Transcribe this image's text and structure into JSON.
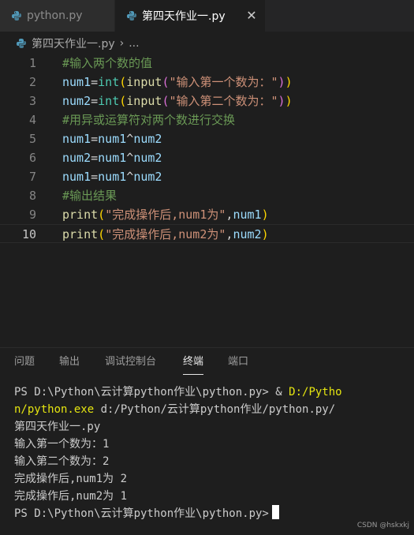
{
  "tabs": [
    {
      "label": "python.py",
      "active": false
    },
    {
      "label": "第四天作业一.py",
      "active": true
    }
  ],
  "breadcrumb": {
    "file": "第四天作业一.py",
    "more": "..."
  },
  "editor": {
    "line_numbers": [
      "1",
      "2",
      "3",
      "4",
      "5",
      "6",
      "7",
      "8",
      "9",
      "10"
    ],
    "current_line": 10,
    "lines": [
      [
        {
          "t": "#输入两个数的值",
          "c": "c-com"
        }
      ],
      [
        {
          "t": "num1",
          "c": "c-var"
        },
        {
          "t": "=",
          "c": "c-op"
        },
        {
          "t": "int",
          "c": "c-type"
        },
        {
          "t": "(",
          "c": "b1"
        },
        {
          "t": "input",
          "c": "c-fn"
        },
        {
          "t": "(",
          "c": "b2"
        },
        {
          "t": "\"输入第一个数为：\"",
          "c": "c-str"
        },
        {
          "t": ")",
          "c": "b2"
        },
        {
          "t": ")",
          "c": "b1"
        }
      ],
      [
        {
          "t": "num2",
          "c": "c-var"
        },
        {
          "t": "=",
          "c": "c-op"
        },
        {
          "t": "int",
          "c": "c-type"
        },
        {
          "t": "(",
          "c": "b1"
        },
        {
          "t": "input",
          "c": "c-fn"
        },
        {
          "t": "(",
          "c": "b2"
        },
        {
          "t": "\"输入第二个数为：\"",
          "c": "c-str"
        },
        {
          "t": ")",
          "c": "b2"
        },
        {
          "t": ")",
          "c": "b1"
        }
      ],
      [
        {
          "t": "#用异或运算符对两个数进行交换",
          "c": "c-com"
        }
      ],
      [
        {
          "t": "num1",
          "c": "c-var"
        },
        {
          "t": "=",
          "c": "c-op"
        },
        {
          "t": "num1",
          "c": "c-var"
        },
        {
          "t": "^",
          "c": "c-op"
        },
        {
          "t": "num2",
          "c": "c-var"
        }
      ],
      [
        {
          "t": "num2",
          "c": "c-var"
        },
        {
          "t": "=",
          "c": "c-op"
        },
        {
          "t": "num1",
          "c": "c-var"
        },
        {
          "t": "^",
          "c": "c-op"
        },
        {
          "t": "num2",
          "c": "c-var"
        }
      ],
      [
        {
          "t": "num1",
          "c": "c-var"
        },
        {
          "t": "=",
          "c": "c-op"
        },
        {
          "t": "num1",
          "c": "c-var"
        },
        {
          "t": "^",
          "c": "c-op"
        },
        {
          "t": "num2",
          "c": "c-var"
        }
      ],
      [
        {
          "t": "#输出结果",
          "c": "c-com"
        }
      ],
      [
        {
          "t": "print",
          "c": "c-fn"
        },
        {
          "t": "(",
          "c": "b1"
        },
        {
          "t": "\"完成操作后,num1为\"",
          "c": "c-str"
        },
        {
          "t": ",",
          "c": "c-op"
        },
        {
          "t": "num1",
          "c": "c-var"
        },
        {
          "t": ")",
          "c": "b1"
        }
      ],
      [
        {
          "t": "print",
          "c": "c-fn"
        },
        {
          "t": "(",
          "c": "b1"
        },
        {
          "t": "\"完成操作后,num2为\"",
          "c": "c-str"
        },
        {
          "t": ",",
          "c": "c-op"
        },
        {
          "t": "num2",
          "c": "c-var"
        },
        {
          "t": ")",
          "c": "b1"
        }
      ]
    ]
  },
  "panel": {
    "tabs": [
      {
        "label": "问题",
        "active": false
      },
      {
        "label": "输出",
        "active": false
      },
      {
        "label": "调试控制台",
        "active": false
      },
      {
        "label": "终端",
        "active": true
      },
      {
        "label": "端口",
        "active": false
      }
    ]
  },
  "terminal": {
    "prompt_cmd": "PS D:\\Python\\云计算python作业\\python.py> & ",
    "exe_part1": "D:/Pytho",
    "exe_part2": "n/python.exe",
    "arg_part1": " d:/Python/云计算python作业/python.py/",
    "arg_part2": "第四天作业一.py",
    "output": [
      "输入第一个数为：1",
      "输入第二个数为：2",
      "完成操作后,num1为 2",
      "完成操作后,num2为 1"
    ],
    "final_prompt": "PS D:\\Python\\云计算python作业\\python.py>"
  },
  "watermark": "CSDN @hskxkj",
  "colors": {
    "python_icon": "#519aba",
    "editor_bg": "#1e1e1e",
    "tabbar_bg": "#252526"
  },
  "icons": [
    "python-file-icon",
    "close-icon"
  ]
}
